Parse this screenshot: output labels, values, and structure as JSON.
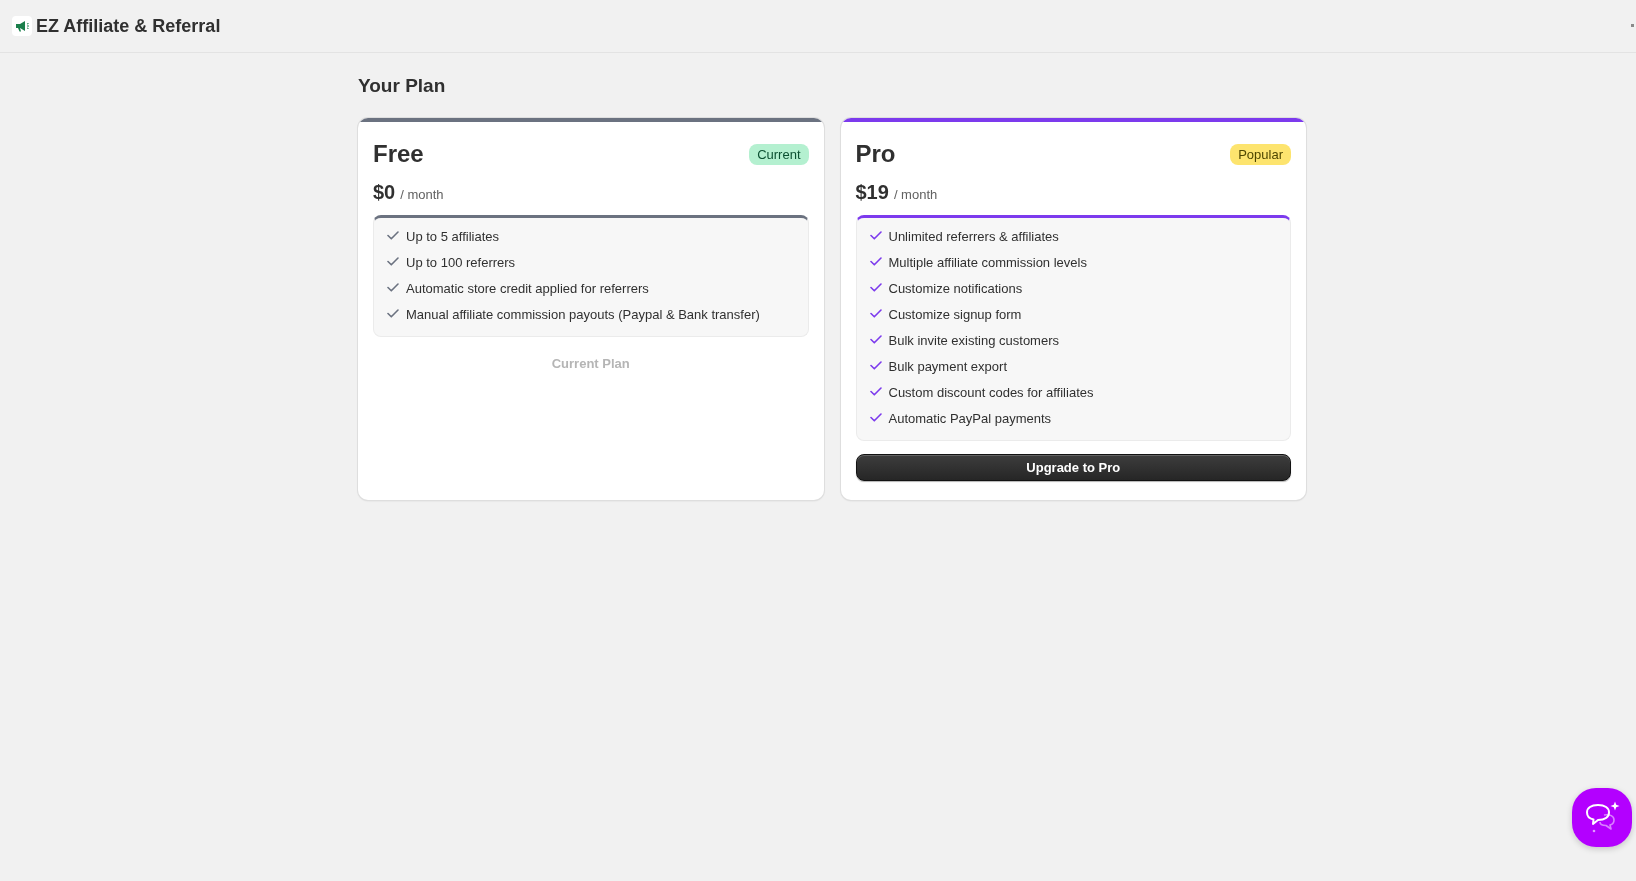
{
  "app": {
    "title": "EZ Affiliate & Referral"
  },
  "page": {
    "title": "Your Plan"
  },
  "plans": [
    {
      "name": "Free",
      "color": "#6b7280",
      "badge": {
        "label": "Current",
        "kind": "current"
      },
      "price": "$0",
      "period": "/ month",
      "features": [
        "Up to 5 affiliates",
        "Up to 100 referrers",
        "Automatic store credit applied for referrers",
        "Manual affiliate commission payouts (Paypal & Bank transfer)"
      ],
      "action": {
        "label": "Current Plan",
        "disabled": true
      }
    },
    {
      "name": "Pro",
      "color": "#7c3aed",
      "badge": {
        "label": "Popular",
        "kind": "popular"
      },
      "price": "$19",
      "period": "/ month",
      "features": [
        "Unlimited referrers & affiliates",
        "Multiple affiliate commission levels",
        "Customize notifications",
        "Customize signup form",
        "Bulk invite existing customers",
        "Bulk payment export",
        "Custom discount codes for affiliates",
        "Automatic PayPal payments"
      ],
      "action": {
        "label": "Upgrade to Pro",
        "disabled": false
      }
    }
  ]
}
